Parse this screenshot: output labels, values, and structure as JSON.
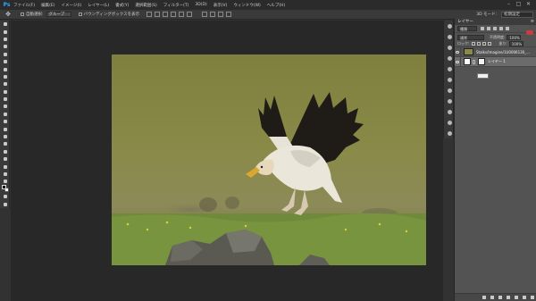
{
  "app": {
    "logo": "Ps"
  },
  "menu": [
    "ファイル(F)",
    "編集(E)",
    "イメージ(I)",
    "レイヤー(L)",
    "書式(Y)",
    "選択範囲(S)",
    "フィルター(T)",
    "3D(D)",
    "表示(V)",
    "ウィンドウ(W)",
    "ヘルプ(H)"
  ],
  "window_buttons": [
    "–",
    "□",
    "✕"
  ],
  "options_bar": {
    "move_icon": "move-icon",
    "auto_select_label": "自動選択:",
    "auto_select_value": "グループ",
    "transform_controls_label": "バウンディングボックスを表示",
    "mode_3d_label": "3D モード:",
    "workspace": "初期設定"
  },
  "tools": [
    "move",
    "marquee",
    "lasso",
    "quick-select",
    "crop",
    "eyedropper",
    "healing",
    "brush",
    "stamp",
    "history-brush",
    "eraser",
    "gradient",
    "blur",
    "dodge",
    "pen",
    "type",
    "path-select",
    "shape",
    "hand",
    "zoom",
    "more",
    "swap",
    "fg-bg",
    "quick-mask",
    "screen-mode"
  ],
  "colors": {
    "foreground": "#000000",
    "background": "#ffffff",
    "panel": "#535353",
    "active_layer": "#6b6b6b",
    "toggle_on": "#cf3b3b"
  },
  "layers_panel": {
    "tab": "レイヤー",
    "filter_kind": "種類",
    "blend_mode": "通常",
    "opacity_label": "不透明度:",
    "opacity": "100%",
    "lock_label": "ロック:",
    "fill_label": "塗り:",
    "fill": "100%",
    "layers": [
      {
        "name": "Stalks/Imagine/1U0006130_..."
      },
      {
        "name": "レイヤー 1"
      }
    ]
  }
}
